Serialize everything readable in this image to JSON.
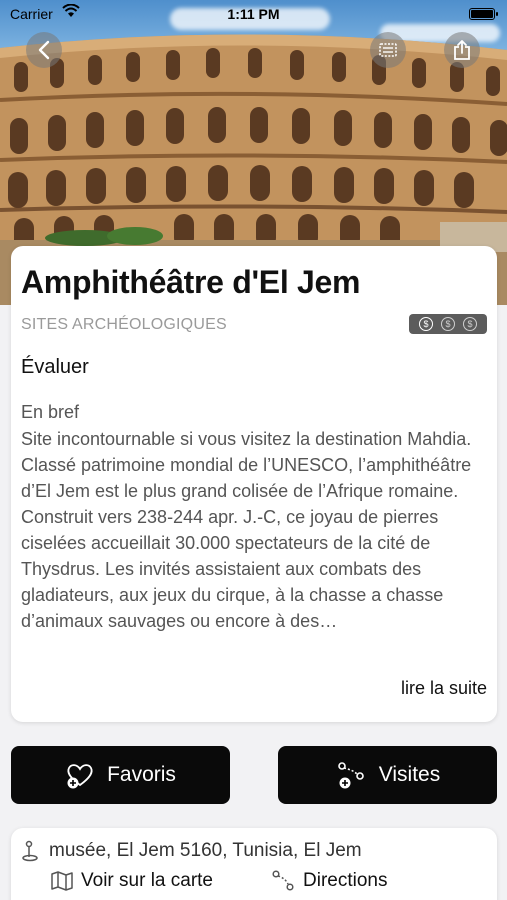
{
  "status_bar": {
    "carrier": "Carrier",
    "time": "1:11 PM"
  },
  "hero": {
    "image": "amphitheatre-photo",
    "icons": [
      "back-icon",
      "ticket-icon",
      "share-icon"
    ]
  },
  "place": {
    "title": "Amphithéâtre d'El Jem",
    "category": "SITES ARCHÉOLOGIQUES",
    "price_level": 1,
    "price_symbols": [
      "$",
      "$",
      "$"
    ],
    "rate_label": "Évaluer",
    "brief_heading": "En bref",
    "brief_text": "Site incontournable si vous visitez la destination Mahdia. Classé patrimoine mondial de l’UNESCO, l’amphithéâtre d’El Jem est le plus grand colisée de l’Afrique romaine. Construit vers 238-244 apr. J.-C, ce joyau de pierres ciselées accueillait 30.000 spectateurs de la cité de Thysdrus. Les invités assistaient aux combats des gladiateurs, aux jeux du cirque, à la chasse a chasse d’animaux sauvages ou encore à des…",
    "read_more": "lire la suite"
  },
  "actions": {
    "favorites": "Favoris",
    "visits": "Visites"
  },
  "location": {
    "address": "musée, El Jem 5160, Tunisia, El Jem",
    "map_link": "Voir sur la carte",
    "directions": "Directions"
  },
  "colors": {
    "button_bg": "#0a0a0a",
    "category": "#9a9a9a",
    "price_badge": "#5c5c5c"
  }
}
